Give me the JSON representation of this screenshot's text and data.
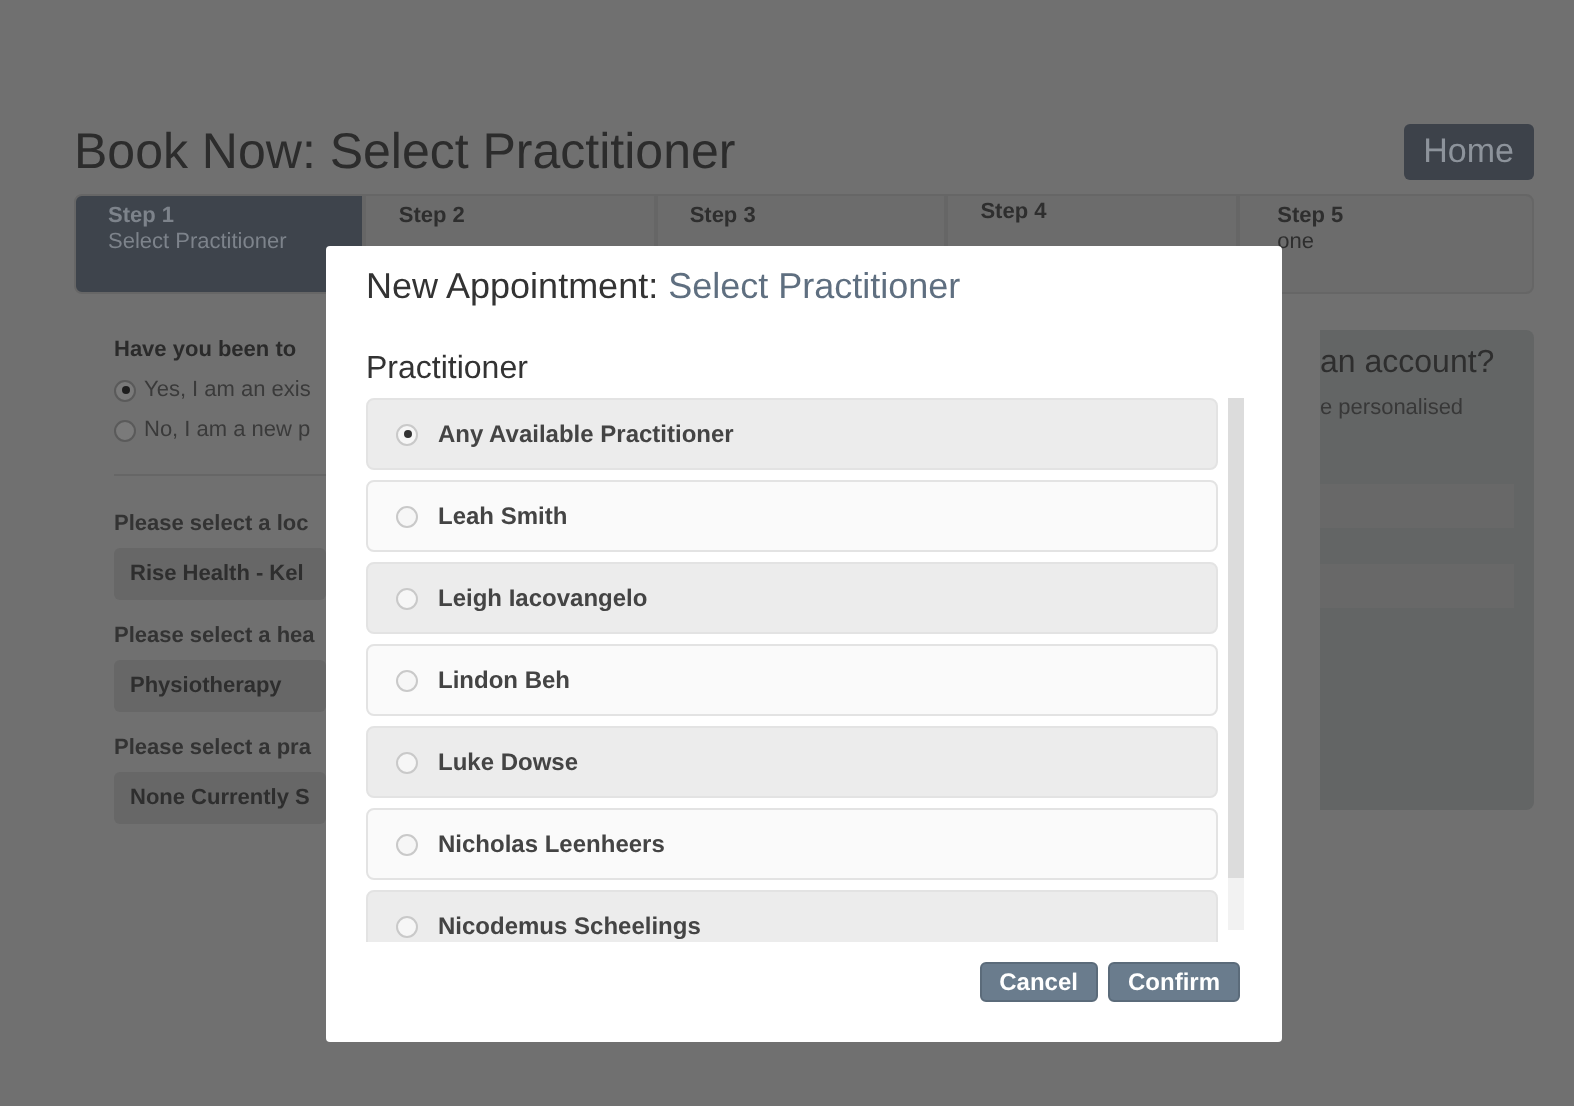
{
  "page": {
    "title": "Book Now: Select Practitioner",
    "home_button": "Home"
  },
  "steps": [
    {
      "label": "Step 1",
      "sub": "Select Practitioner",
      "selected": true
    },
    {
      "label": "Step 2",
      "selected": false
    },
    {
      "label": "Step 3",
      "selected": false
    },
    {
      "label": "Step 4",
      "selected": false
    },
    {
      "label": "Step 5",
      "sub": "one",
      "selected": false
    }
  ],
  "form": {
    "question": "Have you been to",
    "options": [
      {
        "label": "Yes, I am an exis",
        "selected": true
      },
      {
        "label": "No, I am a new p",
        "selected": false
      }
    ],
    "selects": [
      {
        "label": "Please select a loc",
        "value": "Rise Health - Kel"
      },
      {
        "label": "Please select a hea",
        "value": "Physiotherapy"
      },
      {
        "label": "Please select a pra",
        "value": "None Currently S"
      }
    ]
  },
  "account_panel": {
    "title": "an account?",
    "text": "e personalised"
  },
  "modal": {
    "title_prefix": "New Appointment: ",
    "title_highlight": "Select Practitioner",
    "field_label": "Practitioner",
    "practitioners": [
      {
        "name": "Any Available Practitioner",
        "selected": true
      },
      {
        "name": "Leah Smith",
        "selected": false
      },
      {
        "name": "Leigh Iacovangelo",
        "selected": false
      },
      {
        "name": "Lindon Beh",
        "selected": false
      },
      {
        "name": "Luke Dowse",
        "selected": false
      },
      {
        "name": "Nicholas Leenheers",
        "selected": false
      },
      {
        "name": "Nicodemus Scheelings",
        "selected": false
      }
    ],
    "buttons": [
      "Cancel",
      "Confirm"
    ]
  }
}
